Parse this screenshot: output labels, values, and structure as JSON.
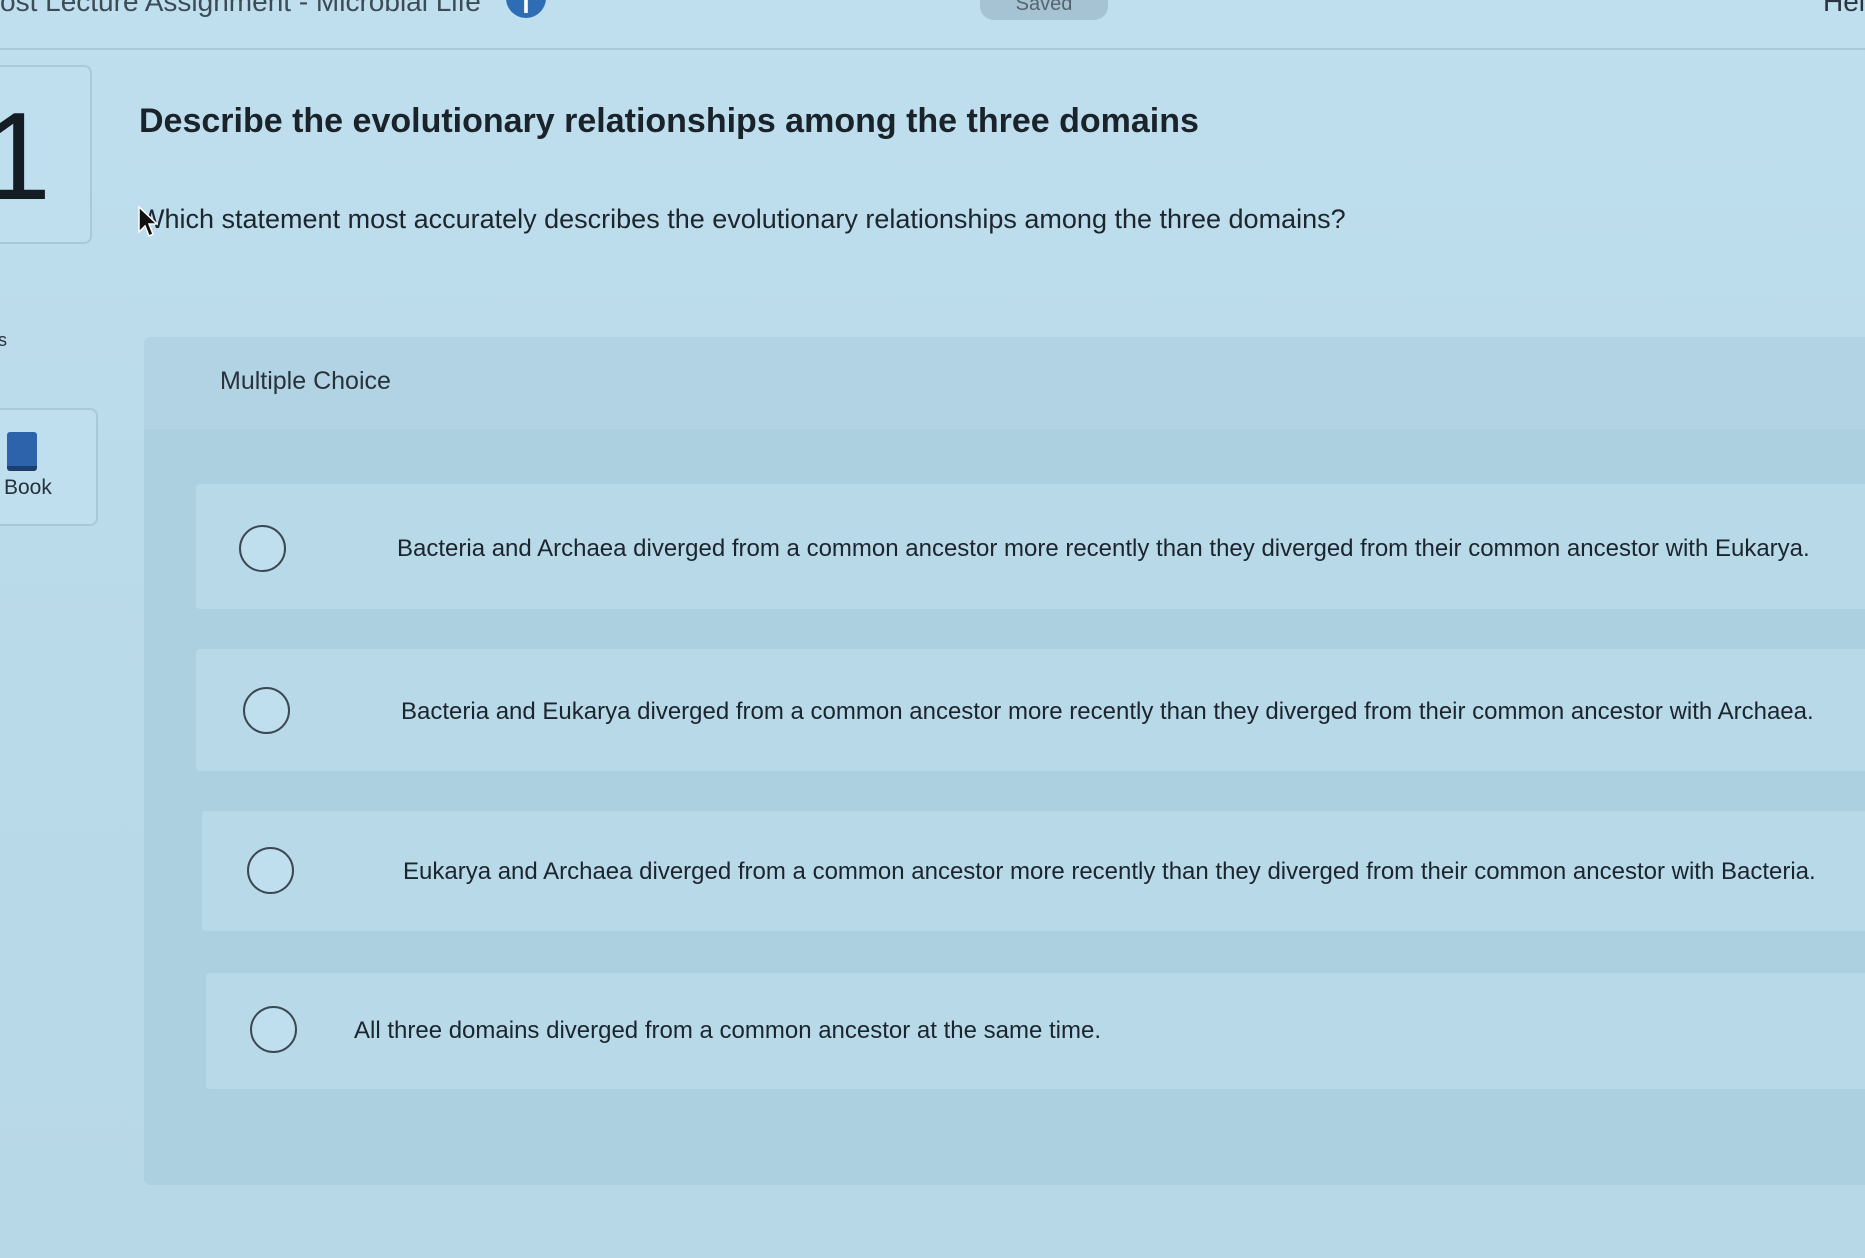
{
  "topbar": {
    "breadcrumb": "ost Lecture Assignment - Microbial Life",
    "info_icon": "i",
    "saved_label": "Saved",
    "help_label": "Hel"
  },
  "sidebar": {
    "question_number": "1",
    "points_fragment": "s",
    "ebook_label": "Book"
  },
  "question": {
    "title": "Describe the evolutionary relationships among the three domains",
    "prompt": "Which statement most accurately describes the evolutionary relationships among the three domains?"
  },
  "multiple_choice": {
    "label": "Multiple Choice",
    "options": [
      {
        "text": "Bacteria and Archaea diverged from a common ancestor more recently than they diverged from their common ancestor with Eukarya.",
        "selected": false
      },
      {
        "text": "Bacteria and Eukarya diverged from a common ancestor more recently than they diverged from their common ancestor with Archaea.",
        "selected": false
      },
      {
        "text": "Eukarya and Archaea diverged from a common ancestor more recently than they diverged from their common ancestor with Bacteria.",
        "selected": false
      },
      {
        "text": "All three domains diverged from a common ancestor at the same time.",
        "selected": false
      }
    ]
  },
  "icons": {
    "info": "info-icon",
    "book": "book-icon",
    "cursor": "cursor-icon",
    "radio": "radio-unselected-icon"
  },
  "colors": {
    "accent": "#2e6db4",
    "background": "#bcdceb",
    "panel": "#add0e1"
  }
}
